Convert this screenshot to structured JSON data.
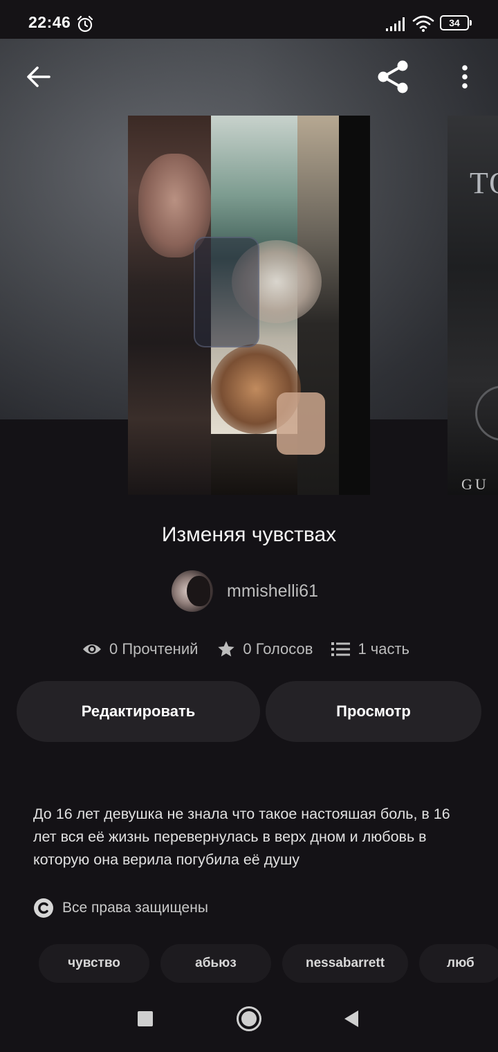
{
  "status_bar": {
    "time": "22:46",
    "battery": "34",
    "icons": [
      "alarm-icon",
      "signal-icon",
      "wifi-icon",
      "battery-icon"
    ]
  },
  "top_bar": {
    "icons": [
      "back-arrow-icon",
      "share-icon",
      "more-vertical-icon"
    ]
  },
  "story": {
    "title": "Изменяя чувствах",
    "author": "mmishelli61",
    "stats": {
      "reads": "0 Прочтений",
      "votes": "0 Голосов",
      "parts": "1 часть"
    },
    "peek_cover_text": {
      "top": "TO",
      "bottom": "GU"
    }
  },
  "actions": {
    "edit_label": "Редактировать",
    "view_label": "Просмотр"
  },
  "description": "До 16 лет девушка не знала что такое настояшая боль, в 16 лет вся её жизнь перевернулась в верх дном и любовь в которую она верила погубила её душу",
  "copyright": "Все права защищены",
  "tags": [
    "чувство",
    "абьюз",
    "nessabarrett",
    "люб"
  ],
  "nav": {
    "icons": [
      "recents-square-icon",
      "home-circle-icon",
      "back-triangle-icon"
    ]
  },
  "colors": {
    "background": "#141216",
    "button_bg": "#242226",
    "tag_bg": "#1d1b1f",
    "text_primary": "#f4f4f4",
    "text_secondary": "#bcbcbc"
  }
}
